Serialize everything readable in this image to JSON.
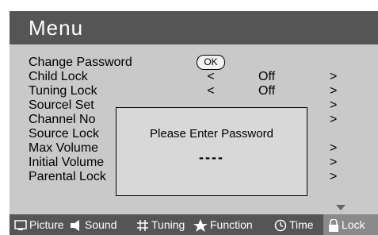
{
  "header": {
    "title": "Menu"
  },
  "menu": {
    "ok_label": "OK",
    "items": [
      {
        "label": "Change Password",
        "sym": "",
        "value": "",
        "arrow": ""
      },
      {
        "label": "Child Lock",
        "sym": "<",
        "value": "Off",
        "arrow": ">"
      },
      {
        "label": "Tuning Lock",
        "sym": "<",
        "value": "Off",
        "arrow": ">"
      },
      {
        "label": "Sourcel Set",
        "sym": "",
        "value": "",
        "arrow": ">"
      },
      {
        "label": "Channel No",
        "sym": "",
        "value": "",
        "arrow": ">"
      },
      {
        "label": "Source Lock",
        "sym": "",
        "value": "",
        "arrow": ""
      },
      {
        "label": "Max Volume",
        "sym": "",
        "value": "",
        "arrow": ">"
      },
      {
        "label": "Initial Volume",
        "sym": "",
        "value": "",
        "arrow": ">"
      },
      {
        "label": "Parental Lock",
        "sym": "",
        "value": "",
        "arrow": ">"
      }
    ]
  },
  "dialog": {
    "prompt": "Please Enter Password",
    "input_mask": "----"
  },
  "tabs": [
    {
      "label": "Picture",
      "icon": "picture-icon"
    },
    {
      "label": "Sound",
      "icon": "sound-icon"
    },
    {
      "label": "Tuning",
      "icon": "tuning-icon"
    },
    {
      "label": "Function",
      "icon": "function-star-icon"
    },
    {
      "label": "Time",
      "icon": "clock-icon"
    },
    {
      "label": "Lock",
      "icon": "lock-icon"
    }
  ],
  "colors": {
    "header_bg": "#555555",
    "panel_bg": "#c9c9c9",
    "active_tab_bg": "#8a8a8a"
  }
}
